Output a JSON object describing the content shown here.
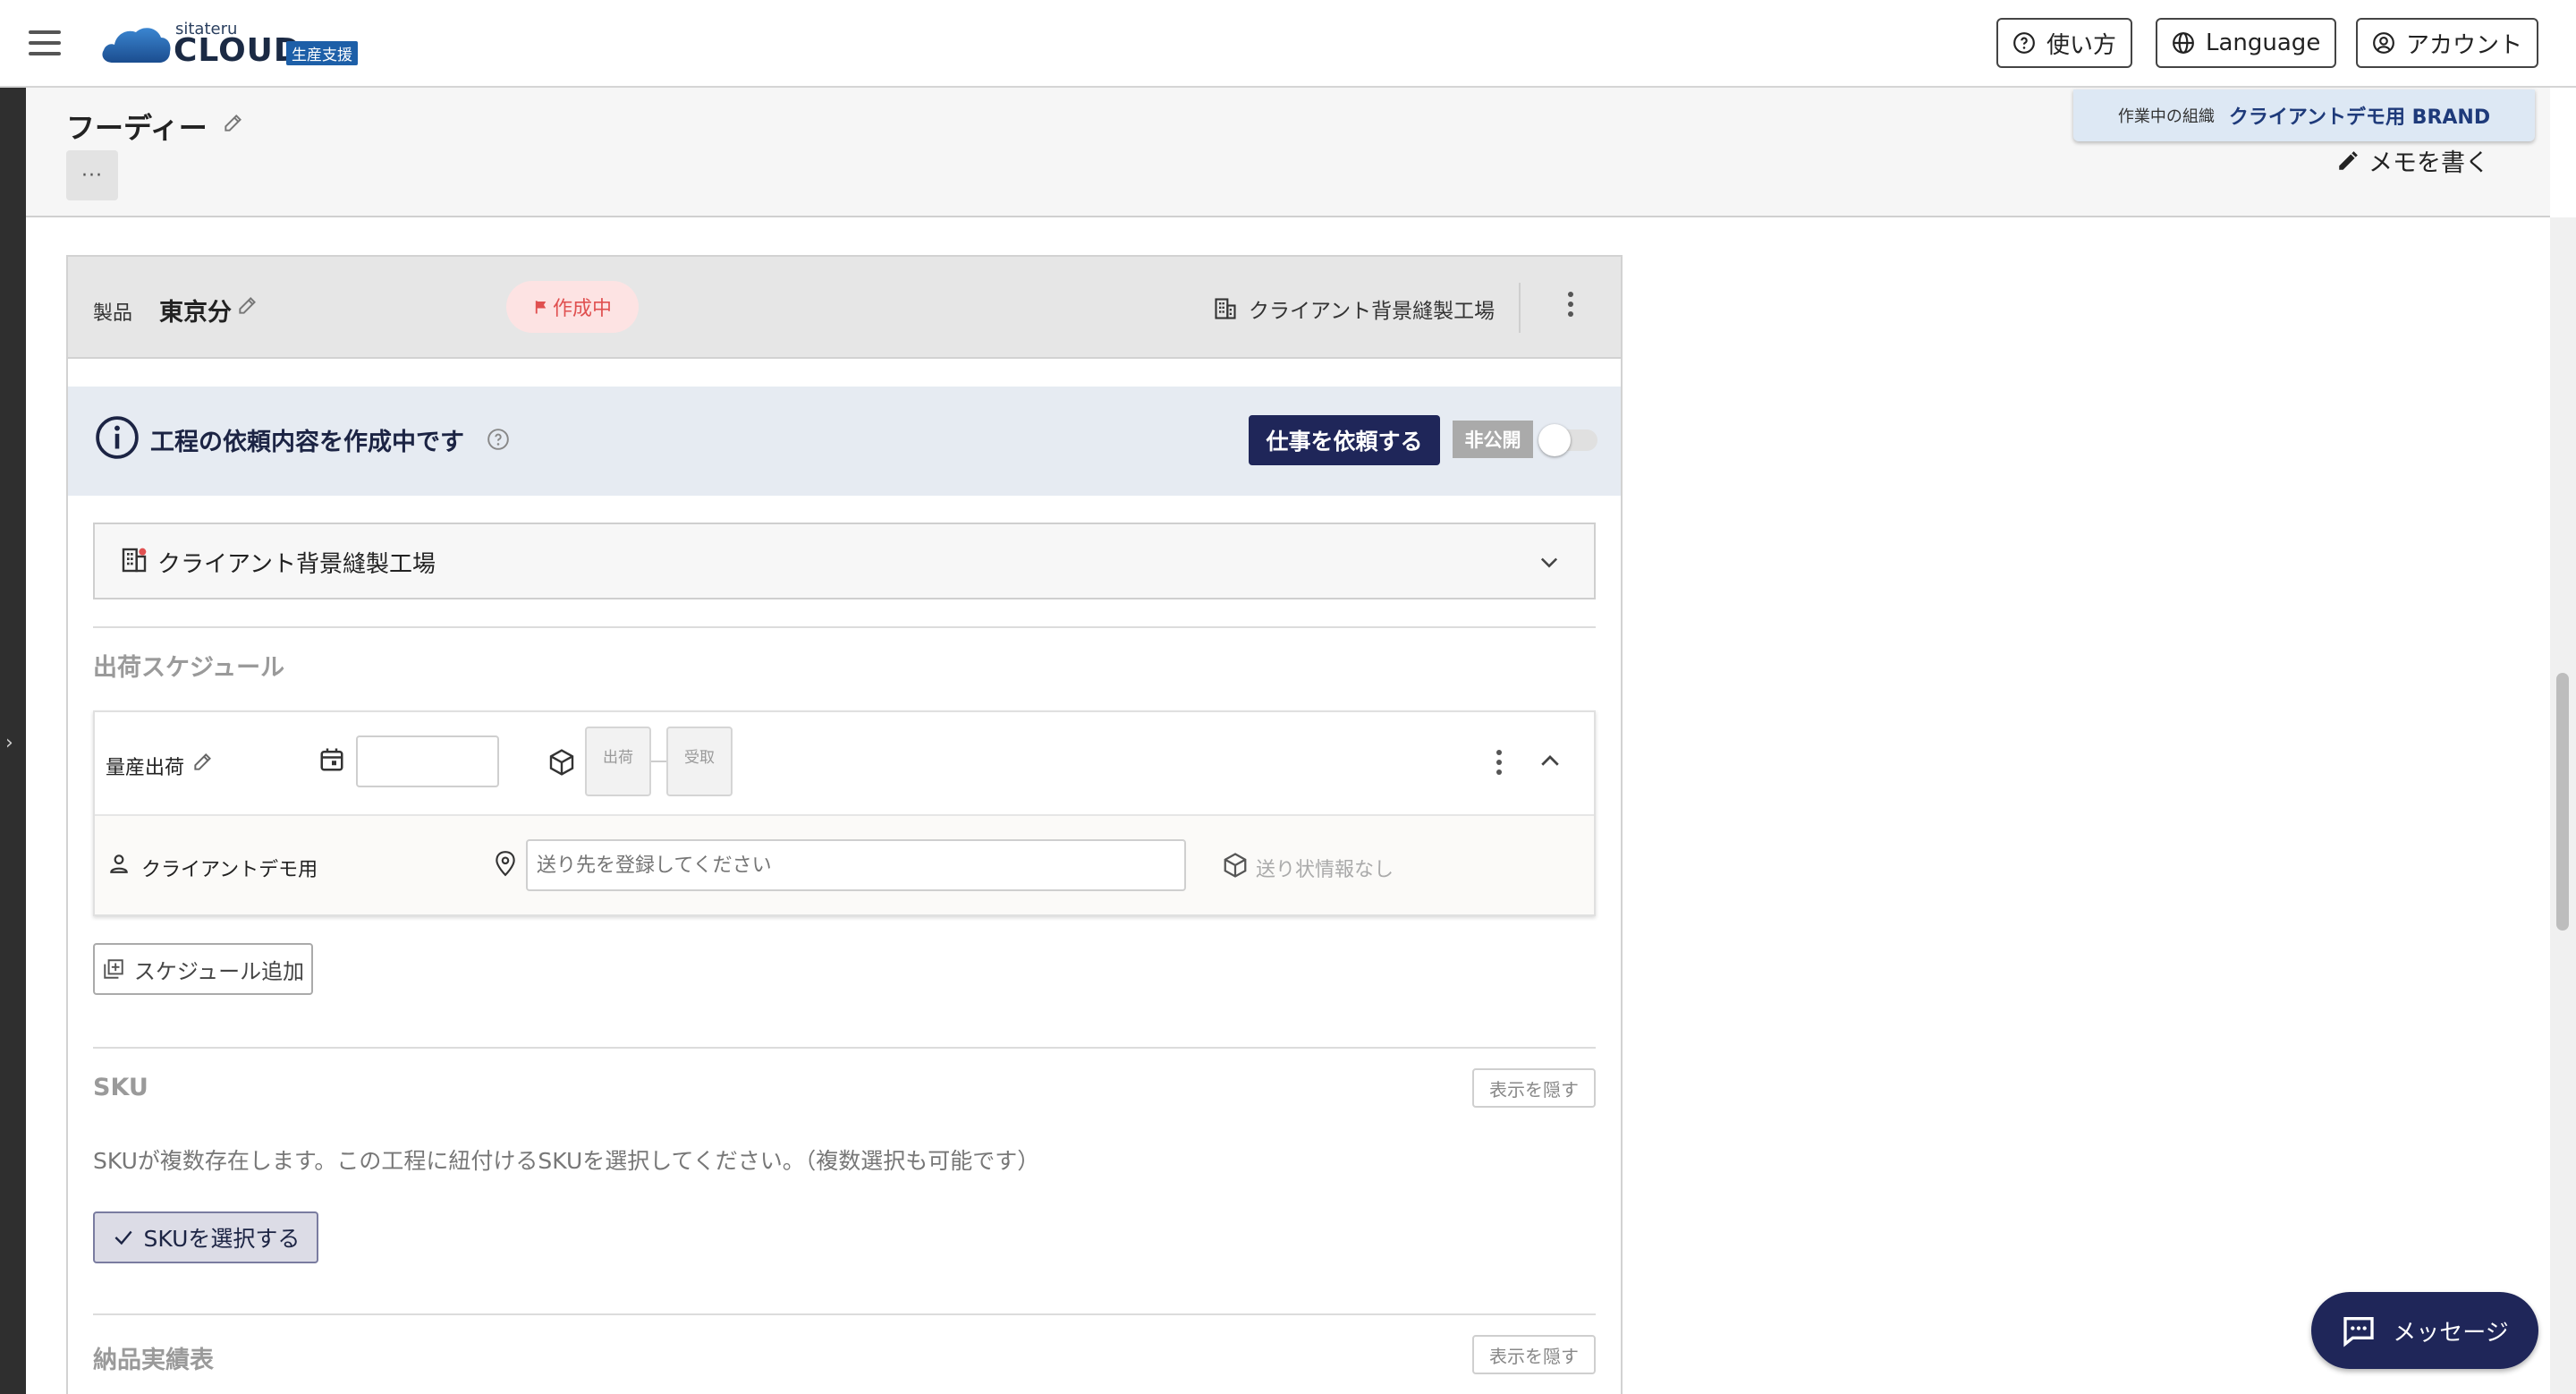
{
  "header": {
    "logo_small": "sitateru",
    "logo_big": "CLOUD",
    "logo_tag": "生産支援",
    "buttons": {
      "help": "使い方",
      "language": "Language",
      "account": "アカウント"
    }
  },
  "org_badge": {
    "label": "作業中の組織",
    "value": "クライアントデモ用 BRAND"
  },
  "page": {
    "title": "フーディー",
    "more": "···",
    "memo": "メモを書く"
  },
  "product": {
    "label": "製品",
    "name": "東京分",
    "status": "作成中",
    "factory": "クライアント背景縫製工場"
  },
  "info_bar": {
    "text": "工程の依頼内容を作成中です",
    "request_button": "仕事を依頼する",
    "visibility": "非公開"
  },
  "factory_select": {
    "value": "クライアント背景縫製工場"
  },
  "schedule": {
    "section_title": "出荷スケジュール",
    "row_name": "量産出荷",
    "chip_ship": "出荷",
    "chip_receive": "受取",
    "recipient": "クライアントデモ用",
    "address_placeholder": "送り先を登録してください",
    "shipping_info": "送り状情報なし",
    "add_button": "スケジュール追加"
  },
  "sku": {
    "section_title": "SKU",
    "hide_button": "表示を隠す",
    "description": "SKUが複数存在します。この工程に紐付けるSKUを選択してください。（複数選択も可能です）",
    "select_button": "SKUを選択する"
  },
  "delivery": {
    "section_title": "納品実績表",
    "hide_button": "表示を隠す"
  },
  "message_button": "メッセージ",
  "colors": {
    "navy": "#1f2659",
    "status_bg": "#fde3e3",
    "status_text": "#e05050",
    "info_bg": "#e6ebf2"
  }
}
